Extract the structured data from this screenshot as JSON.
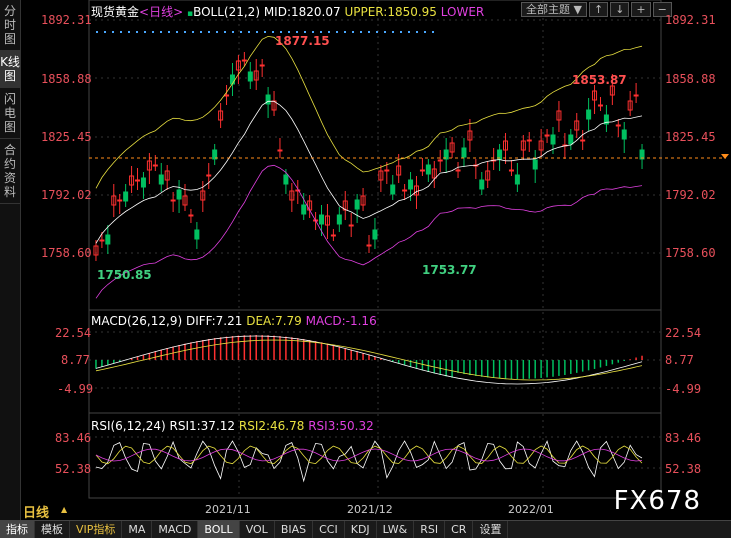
{
  "leftbar": [
    {
      "label": "分时图",
      "active": false
    },
    {
      "label": "K线图",
      "active": true
    },
    {
      "label": "闪电图",
      "active": false
    },
    {
      "label": "合约资料",
      "active": false
    }
  ],
  "main": {
    "symbol": "现货黄金",
    "period": "<日线>",
    "indicator": "BOLL(21,2)",
    "mid": "MID:1820.07",
    "upper": "UPPER:1850.95",
    "lower": "LOWER",
    "theme_button": "全部主题",
    "yticks": [
      "1892.31",
      "1858.88",
      "1825.45",
      "1792.02",
      "1758.60"
    ],
    "labels": {
      "high": "1877.15",
      "low1": "1750.85",
      "low2": "1753.77",
      "recent": "1853.87"
    },
    "colors": {
      "up": "#00c060",
      "down": "#ff3030",
      "mid": "#ffffff",
      "upper": "#e8e040",
      "lower": "#e040e0",
      "price": "#ff8c1a"
    }
  },
  "macd": {
    "title": "MACD(26,12,9)",
    "diff": "DIFF:7.21",
    "dea": "DEA:7.79",
    "macd": "MACD:-1.16",
    "yticks": [
      "22.54",
      "8.77",
      "-4.99"
    ]
  },
  "rsi": {
    "title": "RSI(6,12,24)",
    "rsi1": "RSI1:37.12",
    "rsi2": "RSI2:46.78",
    "rsi3": "RSI3:50.32",
    "yticks": [
      "83.46",
      "52.38"
    ]
  },
  "xaxis": {
    "period_label": "日线",
    "ticks": [
      "2021/11",
      "2021/12",
      "2022/01"
    ]
  },
  "bottombar": [
    "指标",
    "模板",
    "VIP指标",
    "MA",
    "MACD",
    "BOLL",
    "VOL",
    "BIAS",
    "CCI",
    "KDJ",
    "LW&",
    "RSI",
    "CR",
    "设置"
  ],
  "watermark": "FX678"
}
